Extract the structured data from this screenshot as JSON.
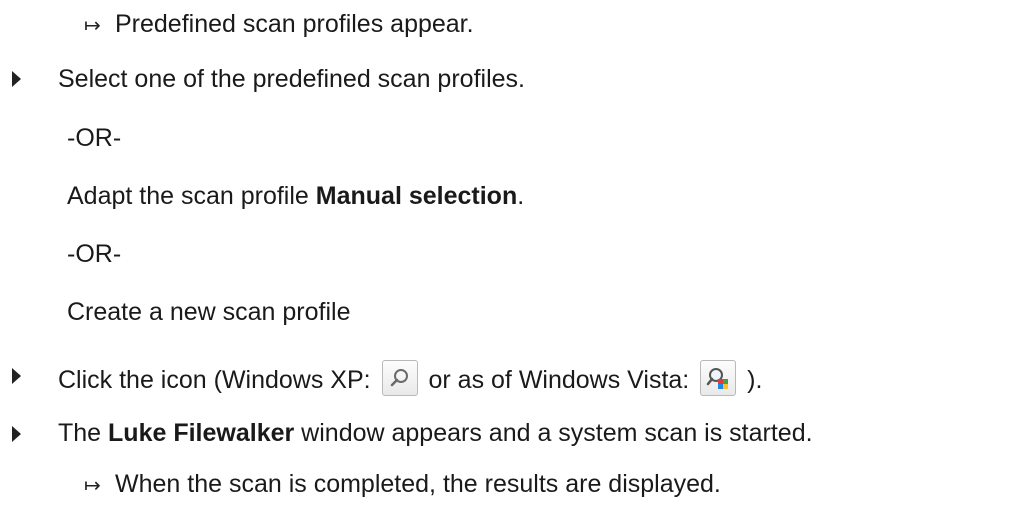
{
  "result_arrow": "↦",
  "steps": {
    "r1": "Predefined scan profiles appear.",
    "s1": "Select one of the predefined scan profiles.",
    "or1": "-OR-",
    "s2_pre": "Adapt the scan profile ",
    "s2_bold": "Manual selection",
    "s2_post": ".",
    "or2": "-OR-",
    "s3": "Create a new scan profile",
    "s4_pre": "Click the icon (Windows XP: ",
    "s4_mid": " or as of Windows Vista: ",
    "s4_post": " ).",
    "s5_pre": "The ",
    "s5_bold": "Luke Filewalker",
    "s5_post": " window appears and a system scan is started.",
    "r2": "When the scan is completed, the results are displayed."
  },
  "icons": {
    "xp": "magnifier-icon",
    "vista": "magnifier-color-icon"
  }
}
